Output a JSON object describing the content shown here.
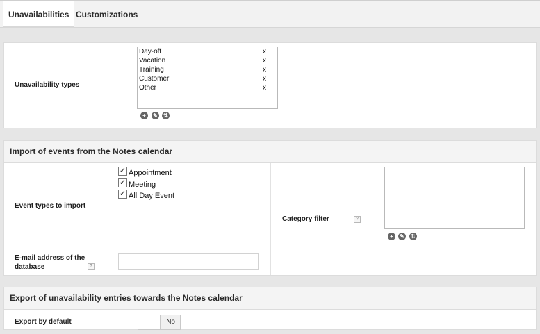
{
  "tabs": [
    {
      "label": "Unavailabilities",
      "active": true
    },
    {
      "label": "Customizations",
      "active": false
    }
  ],
  "unavailability": {
    "label": "Unavailability types",
    "items": [
      {
        "name": "Day-off",
        "remove": "x"
      },
      {
        "name": "Vacation",
        "remove": "x"
      },
      {
        "name": "Training",
        "remove": "x"
      },
      {
        "name": "Customer",
        "remove": "x"
      },
      {
        "name": "Other",
        "remove": "x"
      }
    ],
    "buttons": [
      {
        "name": "add-icon",
        "glyph": "+"
      },
      {
        "name": "edit-icon",
        "glyph": "✎"
      },
      {
        "name": "reorder-icon",
        "glyph": "⇅"
      }
    ]
  },
  "import_section": {
    "title": "Import of events from the Notes calendar",
    "event_types_label": "Event types to import",
    "event_types": [
      {
        "label": "Appointment",
        "checked": true
      },
      {
        "label": "Meeting",
        "checked": true
      },
      {
        "label": "All Day Event",
        "checked": true
      }
    ],
    "category_filter_label": "Category filter",
    "email_label_line1": "E-mail address of the",
    "email_label_line2": "database",
    "email_value": "",
    "help_glyph": "?"
  },
  "export_section": {
    "title": "Export of unavailability entries towards the Notes calendar",
    "export_default_label": "Export by default",
    "toggle_value": "No"
  }
}
